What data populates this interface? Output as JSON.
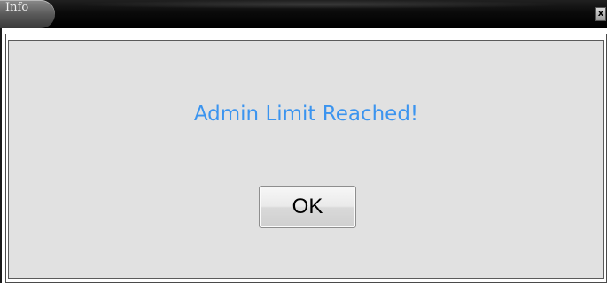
{
  "window": {
    "title": "Info",
    "close_label": "x"
  },
  "dialog": {
    "message": "Admin Limit Reached!",
    "ok_label": "OK"
  },
  "colors": {
    "message": "#3b94ef",
    "dialog_background": "#e1e1e1",
    "titlebar": "#000000"
  },
  "icons": {
    "close": "close-icon"
  }
}
